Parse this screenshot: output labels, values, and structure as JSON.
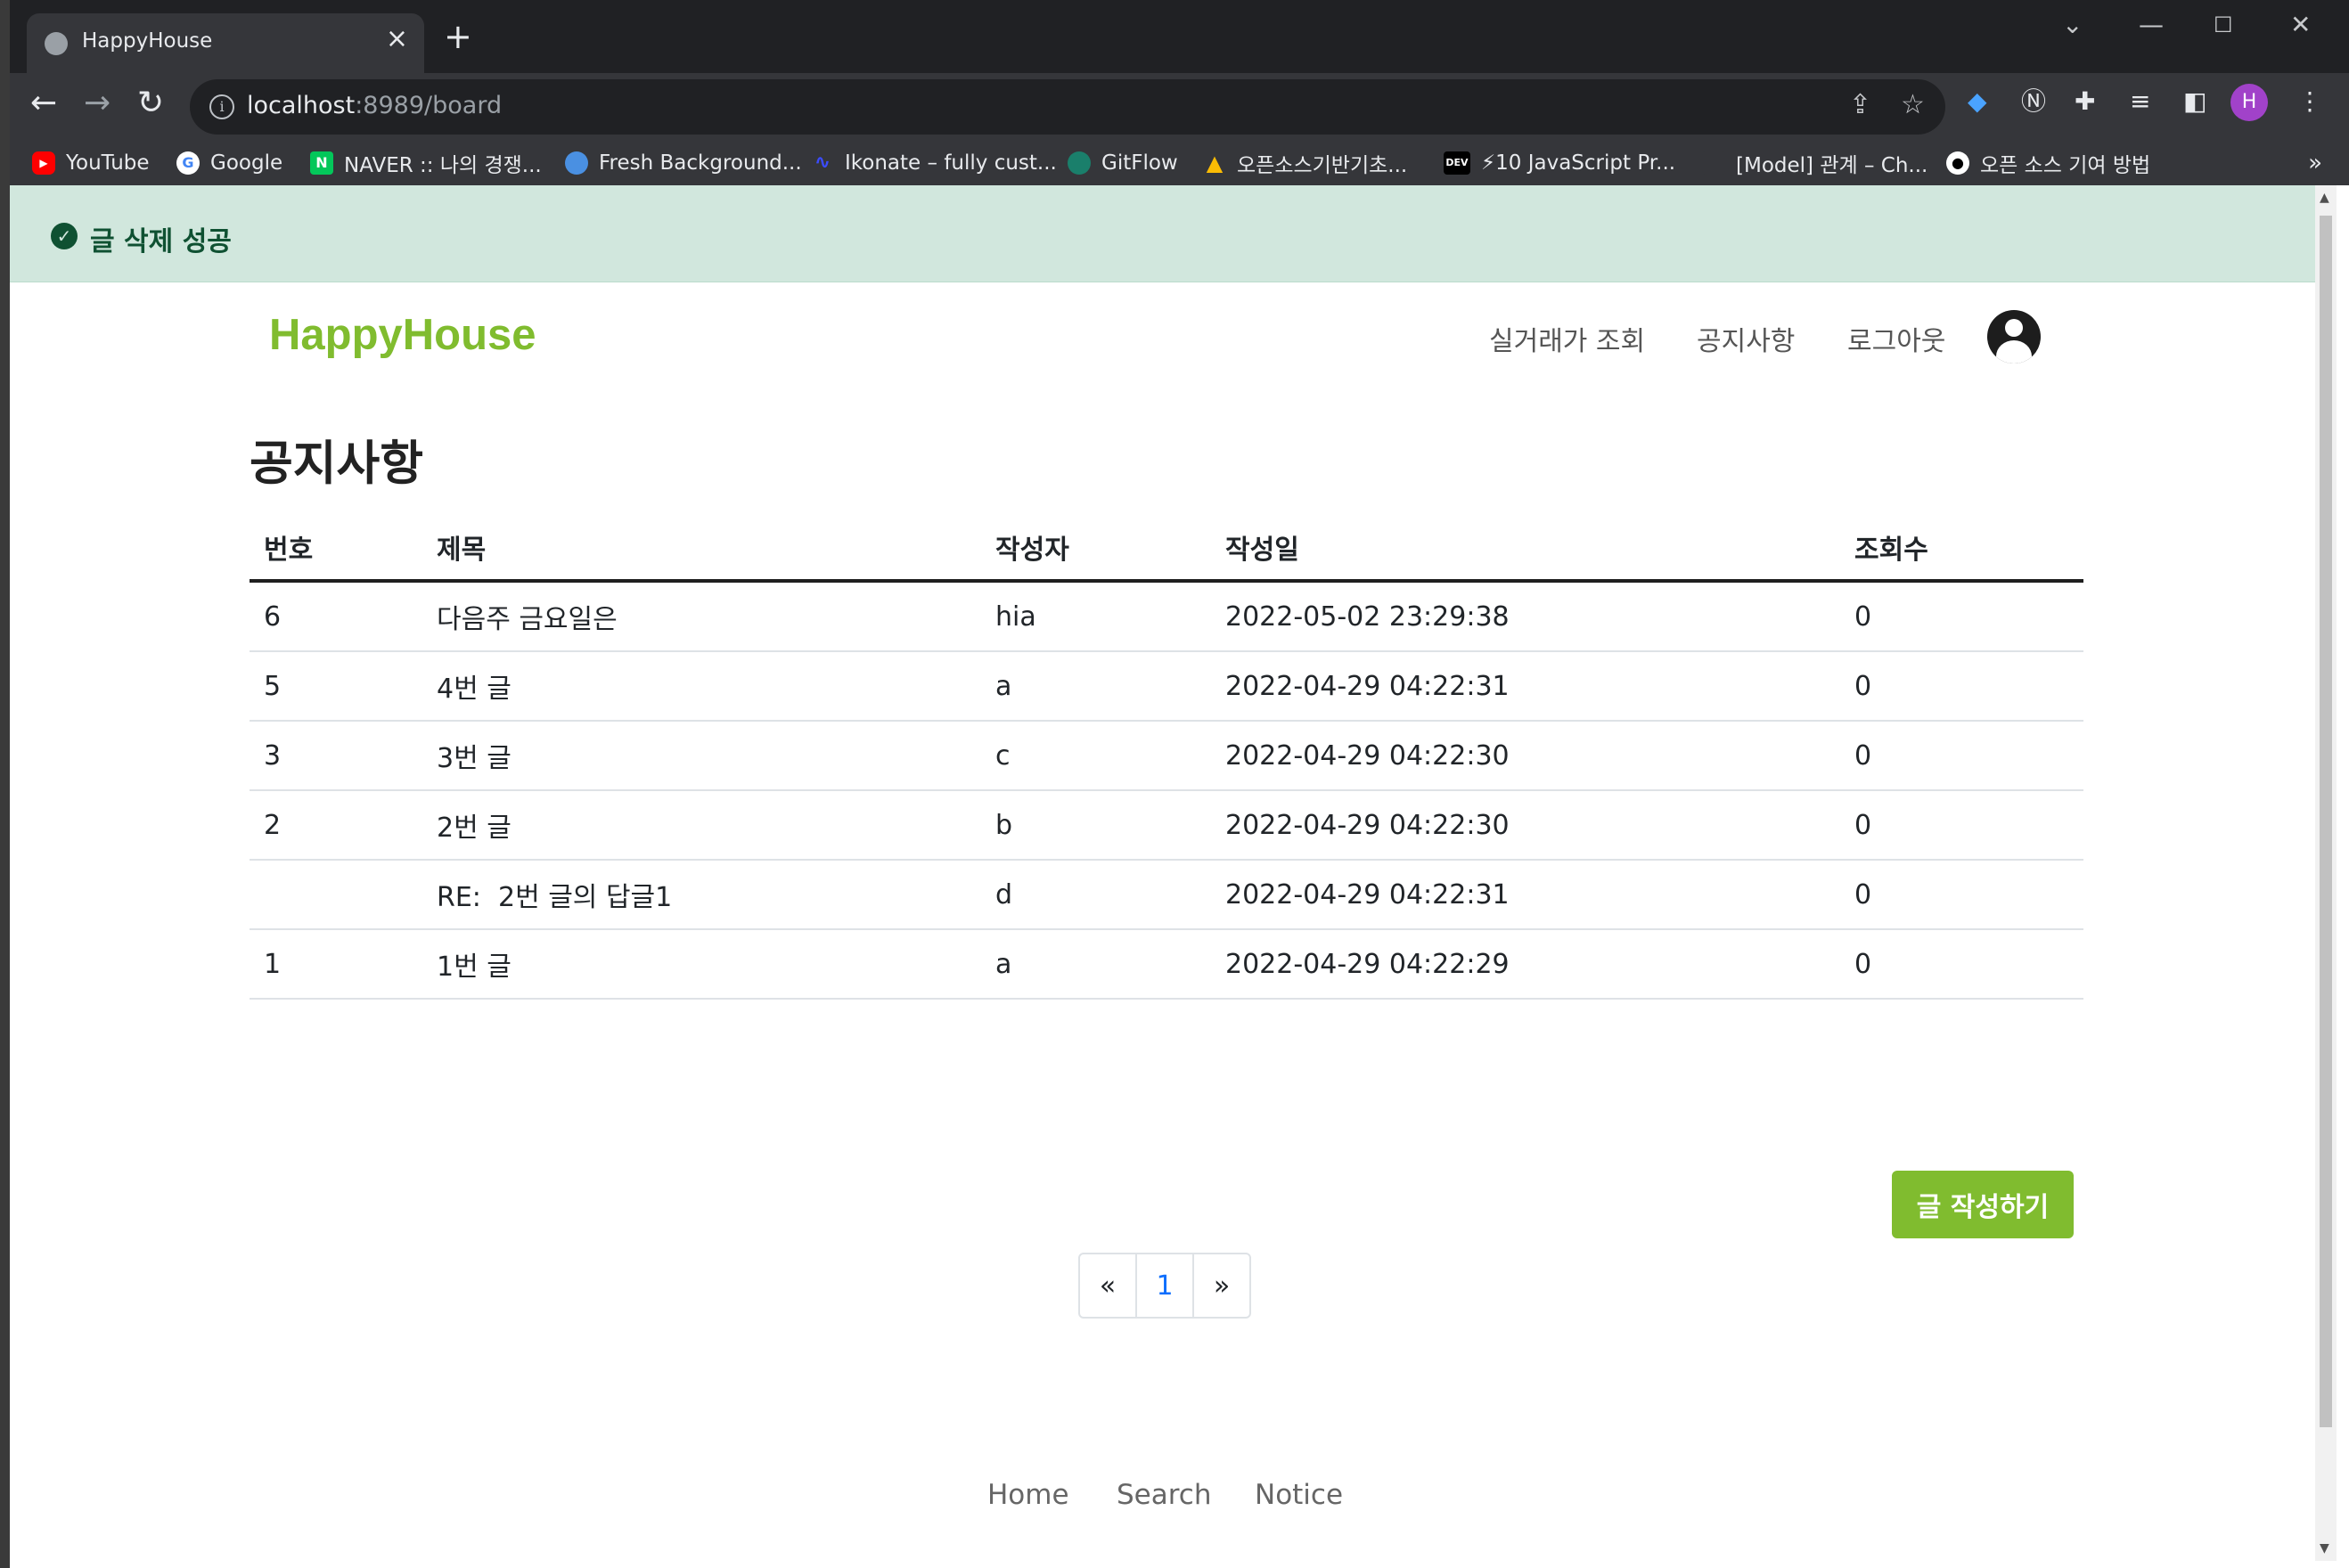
{
  "browser": {
    "tab_title": "HappyHouse",
    "tab_close": "×",
    "new_tab": "+",
    "url_host": "localhost",
    "url_rest": ":8989/board",
    "profile_initial": "H",
    "bookmarks": [
      {
        "label": "YouTube",
        "icon": "youtube-icon",
        "color": "#ff0000"
      },
      {
        "label": "Google",
        "icon": "google-icon",
        "color": "#ffffff"
      },
      {
        "label": "NAVER :: 나의 경쟁...",
        "icon": "naver-icon",
        "color": "#03c75a"
      },
      {
        "label": "Fresh Background...",
        "icon": "fresh-background-icon",
        "color": "#4a90e2"
      },
      {
        "label": "Ikonate – fully cust...",
        "icon": "ikonate-icon",
        "color": "#3b4cff"
      },
      {
        "label": "GitFlow",
        "icon": "gitflow-icon",
        "color": "#1a7f6b"
      },
      {
        "label": "오픈소스기반기초...",
        "icon": "google-drive-icon",
        "color": "#fbbc04"
      },
      {
        "label": "⚡10 JavaScript Pr...",
        "icon": "dev-icon",
        "color": "#000000"
      },
      {
        "label": "[Model] 관계 – Ch...",
        "icon": "blank-icon",
        "color": "#35363a"
      },
      {
        "label": "오픈 소스 기여 방법",
        "icon": "github-icon",
        "color": "#ffffff"
      }
    ],
    "bookmarks_more": "»"
  },
  "alert": {
    "message": "글 삭제 성공",
    "icon": "check-circle-icon",
    "color": "#d1e7dd"
  },
  "header": {
    "brand": "HappyHouse",
    "brand_color": "#80bc2f",
    "nav": [
      "실거래가 조회",
      "공지사항",
      "로그아웃"
    ],
    "user_icon": "user-circle-icon"
  },
  "board": {
    "title": "공지사항",
    "columns": [
      "번호",
      "제목",
      "작성자",
      "작성일",
      "조회수"
    ],
    "rows": [
      [
        "6",
        "다음주 금요일은",
        "hia",
        "2022-05-02 23:29:38",
        "0"
      ],
      [
        "5",
        "4번 글",
        "a",
        "2022-04-29 04:22:31",
        "0"
      ],
      [
        "3",
        "3번 글",
        "c",
        "2022-04-29 04:22:30",
        "0"
      ],
      [
        "2",
        "2번 글",
        "b",
        "2022-04-29 04:22:30",
        "0"
      ],
      [
        "",
        "RE:  2번 글의 답글1",
        "d",
        "2022-04-29 04:22:31",
        "0"
      ],
      [
        "1",
        "1번 글",
        "a",
        "2022-04-29 04:22:29",
        "0"
      ]
    ],
    "write_button": "글 작성하기"
  },
  "pagination": {
    "prev": "«",
    "current": "1",
    "next": "»"
  },
  "footer": {
    "links": [
      "Home",
      "Search",
      "Notice"
    ]
  }
}
